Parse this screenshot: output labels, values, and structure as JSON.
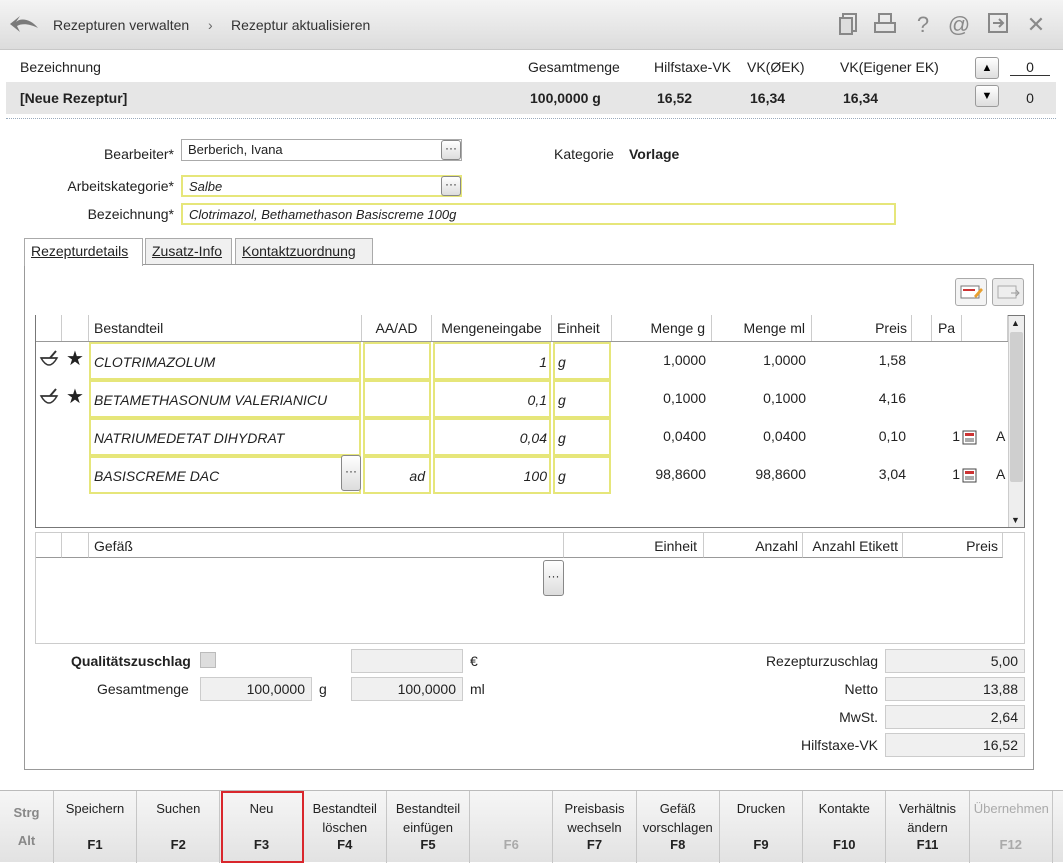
{
  "breadcrumb": {
    "parent": "Rezepturen verwalten",
    "separator": "›",
    "current": "Rezeptur aktualisieren"
  },
  "summary": {
    "headers": {
      "bezeichnung": "Bezeichnung",
      "gesamtmenge": "Gesamtmenge",
      "hilfstaxe_vk": "Hilfstaxe-VK",
      "vk_oek": "VK(ØEK)",
      "vk_eigener_ek": "VK(Eigener EK)"
    },
    "row": {
      "name": "[Neue Rezeptur]",
      "gesamtmenge": "100,0000 g",
      "hilfstaxe_vk": "16,52",
      "vk_oek": "16,34",
      "vk_eigener_ek": "16,34"
    },
    "counter_top": "0",
    "counter_bottom": "0"
  },
  "form": {
    "bearbeiter_label": "Bearbeiter*",
    "bearbeiter_value": "Berberich, Ivana",
    "arbeitskategorie_label": "Arbeitskategorie*",
    "arbeitskategorie_value": "Salbe",
    "bezeichnung_label": "Bezeichnung*",
    "bezeichnung_value": "Clotrimazol, Bethamethason Basiscreme 100g",
    "kategorie_label": "Kategorie",
    "kategorie_value": "Vorlage"
  },
  "tabs": [
    "Rezepturdetails",
    "Zusatz-Info",
    "Kontaktzuordnung"
  ],
  "grid": {
    "headers": {
      "bestandteil": "Bestandteil",
      "aa_ad": "AA/AD",
      "mengeneingabe": "Mengeneingabe",
      "einheit": "Einheit",
      "menge_g": "Menge g",
      "menge_ml": "Menge ml",
      "preis": "Preis",
      "pa": "Pa"
    },
    "rows": [
      {
        "bestandteil": "CLOTRIMAZOLUM",
        "aa_ad": "",
        "mengeneingabe": "1",
        "einheit": "g",
        "menge_g": "1,0000",
        "menge_ml": "1,0000",
        "preis": "1,58",
        "pa": "",
        "extra": "",
        "icons": true
      },
      {
        "bestandteil": "BETAMETHASONUM VALERIANICU",
        "aa_ad": "",
        "mengeneingabe": "0,1",
        "einheit": "g",
        "menge_g": "0,1000",
        "menge_ml": "0,1000",
        "preis": "4,16",
        "pa": "",
        "extra": "",
        "icons": true
      },
      {
        "bestandteil": "NATRIUMEDETAT DIHYDRAT",
        "aa_ad": "",
        "mengeneingabe": "0,04",
        "einheit": "g",
        "menge_g": "0,0400",
        "menge_ml": "0,0400",
        "preis": "0,10",
        "pa": "1",
        "extra": "A",
        "icons": false
      },
      {
        "bestandteil": "BASISCREME DAC",
        "aa_ad": "ad",
        "mengeneingabe": "100",
        "einheit": "g",
        "menge_g": "98,8600",
        "menge_ml": "98,8600",
        "preis": "3,04",
        "pa": "1",
        "extra": "A",
        "icons": false
      }
    ]
  },
  "gefaess": {
    "headers": {
      "gefaess": "Gefäß",
      "einheit": "Einheit",
      "anzahl": "Anzahl",
      "anzahl_etikett": "Anzahl Etikett",
      "preis": "Preis"
    }
  },
  "totals": {
    "qualitaetszuschlag_label": "Qualitätszuschlag",
    "euro": "€",
    "gesamtmenge_label": "Gesamtmenge",
    "gesamtmenge_g": "100,0000",
    "unit_g": "g",
    "gesamtmenge_ml": "100,0000",
    "unit_ml": "ml",
    "rezepturzuschlag_label": "Rezepturzuschlag",
    "rezepturzuschlag": "5,00",
    "netto_label": "Netto",
    "netto": "13,88",
    "mwst_label": "MwSt.",
    "mwst": "2,64",
    "hilfstaxe_label": "Hilfstaxe-VK",
    "hilfstaxe": "16,52"
  },
  "fkeys": {
    "modifiers": {
      "strg": "Strg",
      "alt": "Alt"
    },
    "keys": [
      {
        "label": "Speichern",
        "key": "F1",
        "enabled": true
      },
      {
        "label": "Suchen",
        "key": "F2",
        "enabled": true
      },
      {
        "label": "Neu",
        "key": "F3",
        "enabled": true,
        "highlighted": true
      },
      {
        "label": "Bestandteil löschen",
        "key": "F4",
        "enabled": true
      },
      {
        "label": "Bestandteil einfügen",
        "key": "F5",
        "enabled": true
      },
      {
        "label": "",
        "key": "F6",
        "enabled": false
      },
      {
        "label": "Preisbasis wechseln",
        "key": "F7",
        "enabled": true
      },
      {
        "label": "Gefäß vorschlagen",
        "key": "F8",
        "enabled": true
      },
      {
        "label": "Drucken",
        "key": "F9",
        "enabled": true
      },
      {
        "label": "Kontakte",
        "key": "F10",
        "enabled": true
      },
      {
        "label": "Verhältnis ändern",
        "key": "F11",
        "enabled": true
      },
      {
        "label": "Übernehmen",
        "key": "F12",
        "enabled": false
      }
    ],
    "highlight_color": "#d9262c"
  }
}
